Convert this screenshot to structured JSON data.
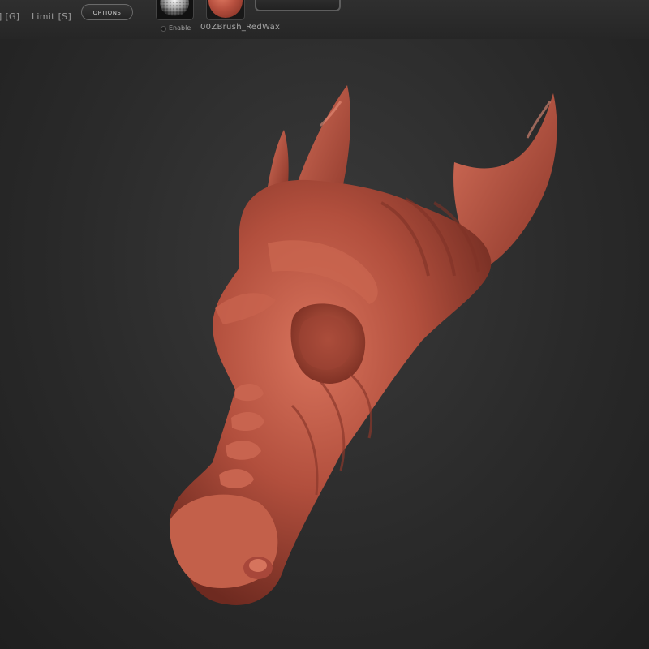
{
  "toolbar": {
    "g_label": "] [G]",
    "limit_label": "Limit [S]",
    "options_label": "OPTIONS",
    "alpha": {
      "icon": "alpha-texture-icon"
    },
    "enable_label": "Enable",
    "material_label": "00ZBrush_RedWax",
    "material_icon": "red-wax-sphere-icon"
  },
  "viewport": {
    "model": "dragon-skull-sculpt",
    "material_color": "#b8523f",
    "background": "#2a2a2a"
  }
}
